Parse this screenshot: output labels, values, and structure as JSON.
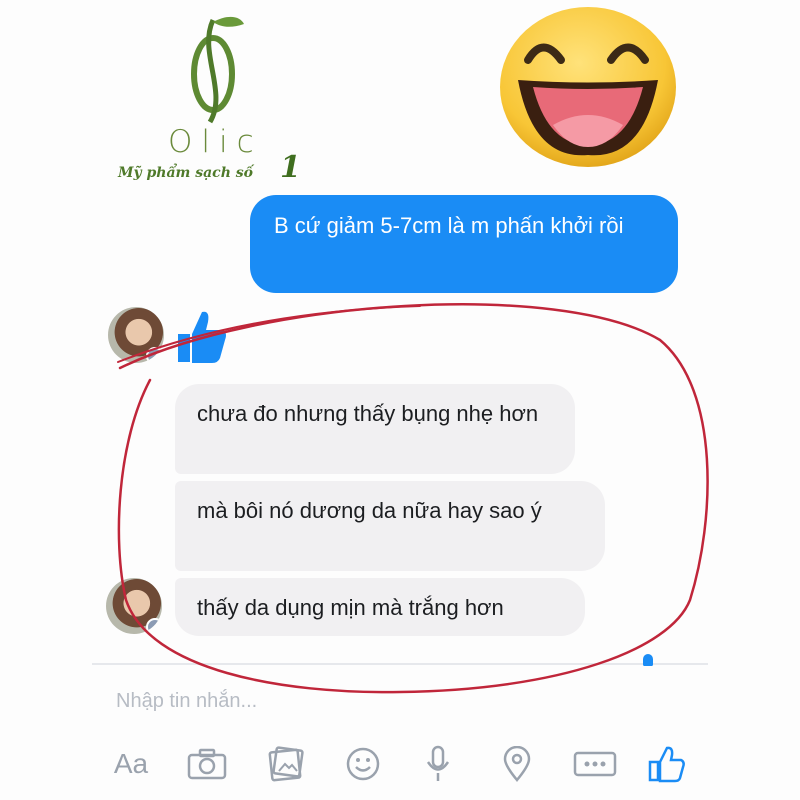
{
  "brand": {
    "logo_mark": "Ø",
    "name": "Olic",
    "tagline": "Mỹ phẩm sạch số",
    "tagline_number": "1",
    "logo_color": "#5e8a33"
  },
  "conversation": {
    "outgoing": {
      "text": "B cứ giảm 5-7cm là m phấn khởi rồi",
      "color": "#1a8cf5"
    },
    "incoming": [
      {
        "text": "chưa đo nhưng thấy bụng nhẹ hơn"
      },
      {
        "text": "mà bôi nó dương da nữa hay sao ý"
      },
      {
        "text": "thấy da dụng mịn mà trắng hơn"
      }
    ],
    "reaction": "thumbs-up-icon"
  },
  "composer": {
    "placeholder": "Nhập tin nhắn...",
    "tools": [
      {
        "name": "text-style-button",
        "label": "Aa"
      },
      {
        "name": "camera-icon"
      },
      {
        "name": "gallery-icon"
      },
      {
        "name": "emoji-icon"
      },
      {
        "name": "microphone-icon"
      },
      {
        "name": "location-icon"
      },
      {
        "name": "more-icon"
      },
      {
        "name": "like-icon"
      }
    ],
    "accent": "#1a8cf5",
    "icon_color": "#9aa2ad"
  },
  "annotation": {
    "marker_color": "#c0263a"
  }
}
